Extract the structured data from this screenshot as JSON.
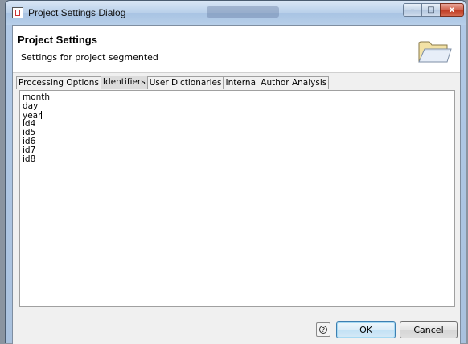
{
  "window": {
    "title": "Project Settings Dialog",
    "controls": {
      "minimize": "–",
      "maximize": "□",
      "close": "x"
    }
  },
  "header": {
    "title": "Project Settings",
    "subtitle": "Settings for project segmented",
    "icon": "open-folder-icon"
  },
  "tabs": [
    {
      "label": "Processing Options",
      "active": false
    },
    {
      "label": "Identifiers",
      "active": true
    },
    {
      "label": "User Dictionaries",
      "active": false
    },
    {
      "label": "Internal Author Analysis",
      "active": false
    }
  ],
  "identifiers": {
    "items": [
      "month",
      "day",
      "year",
      "id4",
      "id5",
      "id6",
      "id7",
      "id8"
    ],
    "caret_after_item": 2
  },
  "buttons": {
    "help_icon": "?",
    "ok": "OK",
    "cancel": "Cancel"
  },
  "colors": {
    "titlebar": "#b9d0ea",
    "dialog_bg": "#f0f0f0",
    "ok_border": "#3c7fb1",
    "close_button": "#c9452c"
  }
}
